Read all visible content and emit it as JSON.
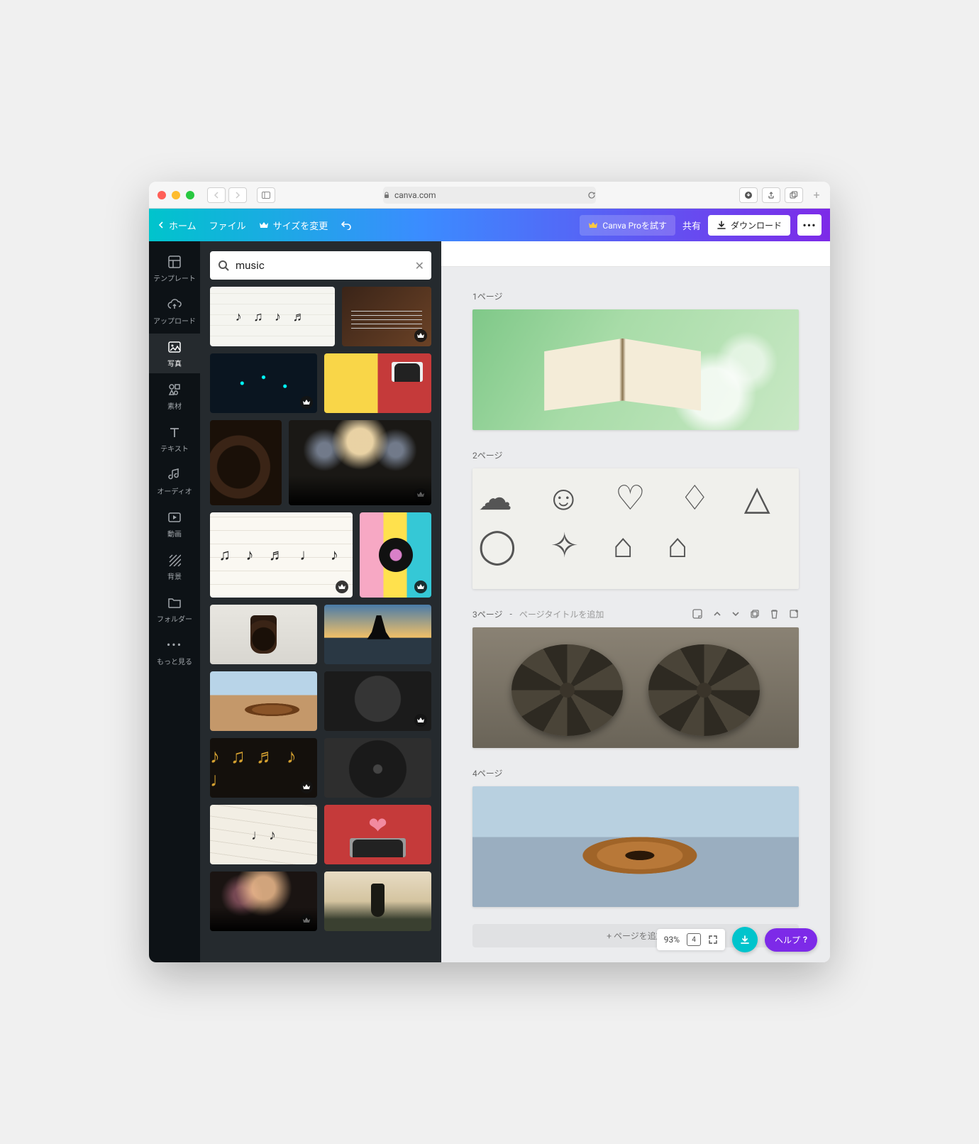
{
  "browser": {
    "url_host": "canva.com"
  },
  "header": {
    "back_label": "ホーム",
    "file_label": "ファイル",
    "resize_label": "サイズを変更",
    "pro_label": "Canva Proを試す",
    "share_label": "共有",
    "download_label": "ダウンロード"
  },
  "leftnav": {
    "templates": "テンプレート",
    "uploads": "アップロード",
    "photos": "写真",
    "elements": "素材",
    "text": "テキスト",
    "audio": "オーディオ",
    "video": "動画",
    "background": "背景",
    "folders": "フォルダー",
    "more": "もっと見る"
  },
  "search": {
    "value": "music",
    "placeholder": "music"
  },
  "pages": {
    "p1": "1ページ",
    "p2": "2ページ",
    "p3": "3ページ",
    "p3_add_title": "ページタイトルを追加",
    "p4": "4ページ",
    "add_page": "+ ページを追加"
  },
  "bottom": {
    "zoom": "93%",
    "page_count": "4",
    "help": "ヘルプ",
    "help_q": "?"
  }
}
